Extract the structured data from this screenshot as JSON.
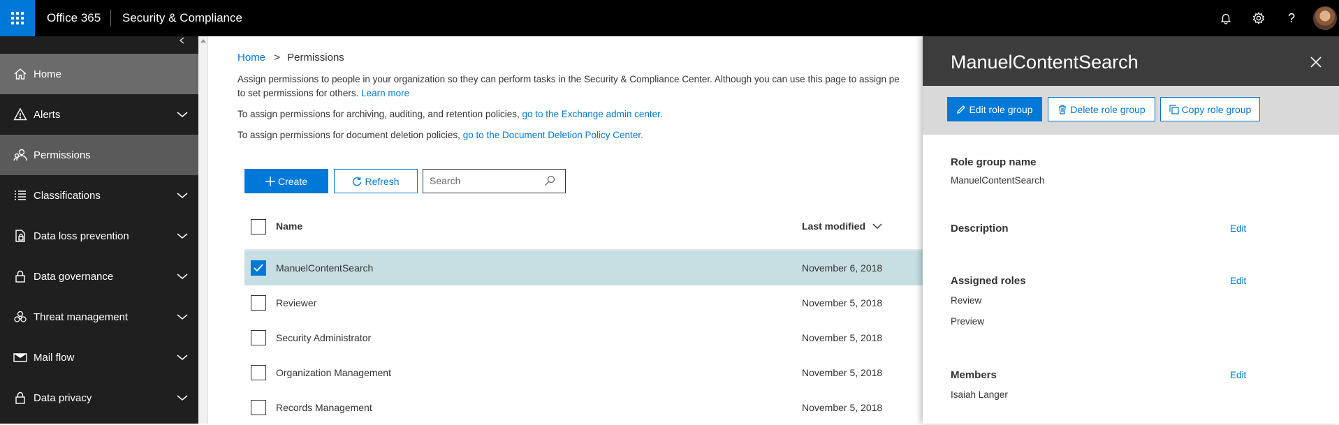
{
  "topbar": {
    "brand": "Office 365",
    "app_name": "Security & Compliance",
    "colors": {
      "background": "#000000",
      "waffle": "#0078d7"
    },
    "icons": [
      "waffle-icon",
      "bell-icon",
      "gear-icon",
      "help-icon"
    ]
  },
  "sidebar": {
    "items": [
      {
        "label": "Home",
        "icon": "home-icon"
      },
      {
        "label": "Alerts",
        "icon": "alert-icon"
      },
      {
        "label": "Permissions",
        "icon": "people-icon"
      },
      {
        "label": "Classifications",
        "icon": "list-icon"
      },
      {
        "label": "Data loss prevention",
        "icon": "dlp-icon"
      },
      {
        "label": "Data governance",
        "icon": "lock-icon"
      },
      {
        "label": "Threat management",
        "icon": "biohazard-icon"
      },
      {
        "label": "Mail flow",
        "icon": "mail-icon"
      },
      {
        "label": "Data privacy",
        "icon": "lock-icon"
      }
    ]
  },
  "main": {
    "breadcrumb": {
      "home": "Home",
      "separator": ">",
      "current": "Permissions"
    },
    "description": {
      "line1": "Assign permissions to people in your organization so they can perform tasks in the Security & Compliance Center. Although you can use this page to assign pe",
      "line2": "to set permissions for others.",
      "learn_more": "Learn more",
      "exchange_prefix": "To assign permissions for archiving, auditing, and retention policies,",
      "exchange_link": "go to the Exchange admin center.",
      "deletion_prefix": "To assign permissions for document deletion policies,",
      "deletion_link": "go to the Document Deletion Policy Center."
    },
    "toolbar": {
      "create": "Create",
      "refresh": "Refresh",
      "search_placeholder": "Search"
    },
    "table": {
      "columns": {
        "name": "Name",
        "last_modified": "Last modified"
      },
      "rows": [
        {
          "name": "ManuelContentSearch",
          "date": "November 6, 2018",
          "checked": true
        },
        {
          "name": "Reviewer",
          "date": "November 5, 2018",
          "checked": false
        },
        {
          "name": "Security Administrator",
          "date": "November 5, 2018",
          "checked": false
        },
        {
          "name": "Organization Management",
          "date": "November 5, 2018",
          "checked": false
        },
        {
          "name": "Records Management",
          "date": "November 5, 2018",
          "checked": false
        }
      ]
    }
  },
  "panel": {
    "title": "ManuelContentSearch",
    "buttons": {
      "edit": "Edit role group",
      "delete": "Delete role group",
      "copy": "Copy role group"
    },
    "role_group_name_label": "Role group name",
    "role_group_name": "ManuelContentSearch",
    "description_label": "Description",
    "assigned_roles_label": "Assigned roles",
    "assigned_roles": [
      "Review",
      "Preview"
    ],
    "members_label": "Members",
    "members": [
      "Isaiah Langer"
    ],
    "edit": "Edit"
  }
}
